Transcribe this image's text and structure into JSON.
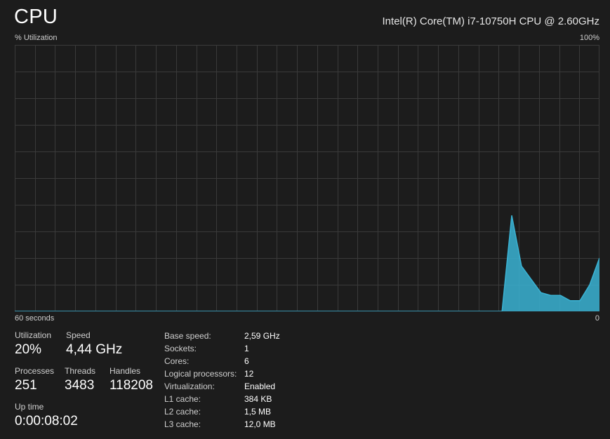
{
  "header": {
    "title": "CPU",
    "cpu_model": "Intel(R) Core(TM) i7-10750H CPU @ 2.60GHz",
    "utilization_label": "% Utilization",
    "max_label": "100%"
  },
  "graph": {
    "time_label": "60 seconds",
    "zero_label": "0",
    "accent_color": "#3ab3d4",
    "grid_color": "#3a3a3a"
  },
  "chart_data": {
    "type": "area",
    "x_range": [
      60,
      0
    ],
    "ylim": [
      0,
      100
    ],
    "x": [
      60,
      59,
      58,
      57,
      56,
      55,
      54,
      53,
      52,
      51,
      50,
      49,
      48,
      47,
      46,
      45,
      44,
      43,
      42,
      41,
      40,
      39,
      38,
      37,
      36,
      35,
      34,
      33,
      32,
      31,
      30,
      29,
      28,
      27,
      26,
      25,
      24,
      23,
      22,
      21,
      20,
      19,
      18,
      17,
      16,
      15,
      14,
      13,
      12,
      11,
      10,
      9,
      8,
      7,
      6,
      5,
      4,
      3,
      2,
      1,
      0
    ],
    "values": [
      0,
      0,
      0,
      0,
      0,
      0,
      0,
      0,
      0,
      0,
      0,
      0,
      0,
      0,
      0,
      0,
      0,
      0,
      0,
      0,
      0,
      0,
      0,
      0,
      0,
      0,
      0,
      0,
      0,
      0,
      0,
      0,
      0,
      0,
      0,
      0,
      0,
      0,
      0,
      0,
      0,
      0,
      0,
      0,
      0,
      0,
      0,
      0,
      0,
      0,
      0,
      36,
      17,
      12,
      7,
      6,
      6,
      4,
      4,
      10,
      20
    ]
  },
  "stats": {
    "utilization": {
      "label": "Utilization",
      "value": "20%"
    },
    "speed": {
      "label": "Speed",
      "value": "4,44 GHz"
    },
    "processes": {
      "label": "Processes",
      "value": "251"
    },
    "threads": {
      "label": "Threads",
      "value": "3483"
    },
    "handles": {
      "label": "Handles",
      "value": "118208"
    },
    "uptime": {
      "label": "Up time",
      "value": "0:00:08:02"
    }
  },
  "specs": [
    {
      "key": "Base speed:",
      "value": "2,59 GHz"
    },
    {
      "key": "Sockets:",
      "value": "1"
    },
    {
      "key": "Cores:",
      "value": "6"
    },
    {
      "key": "Logical processors:",
      "value": "12"
    },
    {
      "key": "Virtualization:",
      "value": "Enabled"
    },
    {
      "key": "L1 cache:",
      "value": "384 KB"
    },
    {
      "key": "L2 cache:",
      "value": "1,5 MB"
    },
    {
      "key": "L3 cache:",
      "value": "12,0 MB"
    }
  ]
}
